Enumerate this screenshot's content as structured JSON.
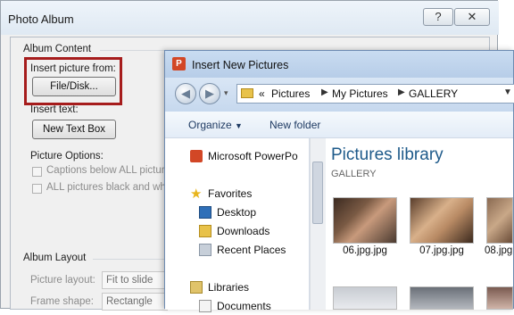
{
  "photo_album": {
    "title": "Photo Album",
    "help_glyph": "?",
    "close_glyph": "✕",
    "album_content": "Album Content",
    "insert_picture_from": "Insert picture from:",
    "file_disk_button": "File/Disk...",
    "insert_text": "Insert text:",
    "new_text_box_button": "New Text Box",
    "picture_options": "Picture Options:",
    "captions_below": "Captions below ALL pictures",
    "all_black_white": "ALL pictures black and white",
    "album_layout": "Album Layout",
    "picture_layout_label": "Picture layout:",
    "picture_layout_value": "Fit to slide",
    "frame_shape_label": "Frame shape:",
    "frame_shape_value": "Rectangle",
    "highlight_color": "#a61c1c"
  },
  "insert_pictures": {
    "title": "Insert New Pictures",
    "app_icon_letter": "P",
    "breadcrumb": [
      "«",
      "Pictures",
      "My Pictures",
      "GALLERY"
    ],
    "toolbar": {
      "organize": "Organize",
      "new_folder": "New folder"
    },
    "nav_items": [
      {
        "label": "Microsoft PowerPo",
        "icon": "powerpoint-icon"
      },
      {
        "label": "Favorites",
        "icon": "star-icon"
      },
      {
        "label": "Desktop",
        "icon": "desktop-icon"
      },
      {
        "label": "Downloads",
        "icon": "downloads-icon"
      },
      {
        "label": "Recent Places",
        "icon": "recent-places-icon"
      },
      {
        "label": "Libraries",
        "icon": "libraries-icon"
      },
      {
        "label": "Documents",
        "icon": "documents-icon"
      }
    ],
    "library_title": "Pictures library",
    "library_subtitle": "GALLERY",
    "thumbnails": [
      {
        "label": "06.jpg.jpg"
      },
      {
        "label": "07.jpg.jpg"
      },
      {
        "label": "08.jpg"
      }
    ],
    "accent_color": "#1e5a8a"
  }
}
